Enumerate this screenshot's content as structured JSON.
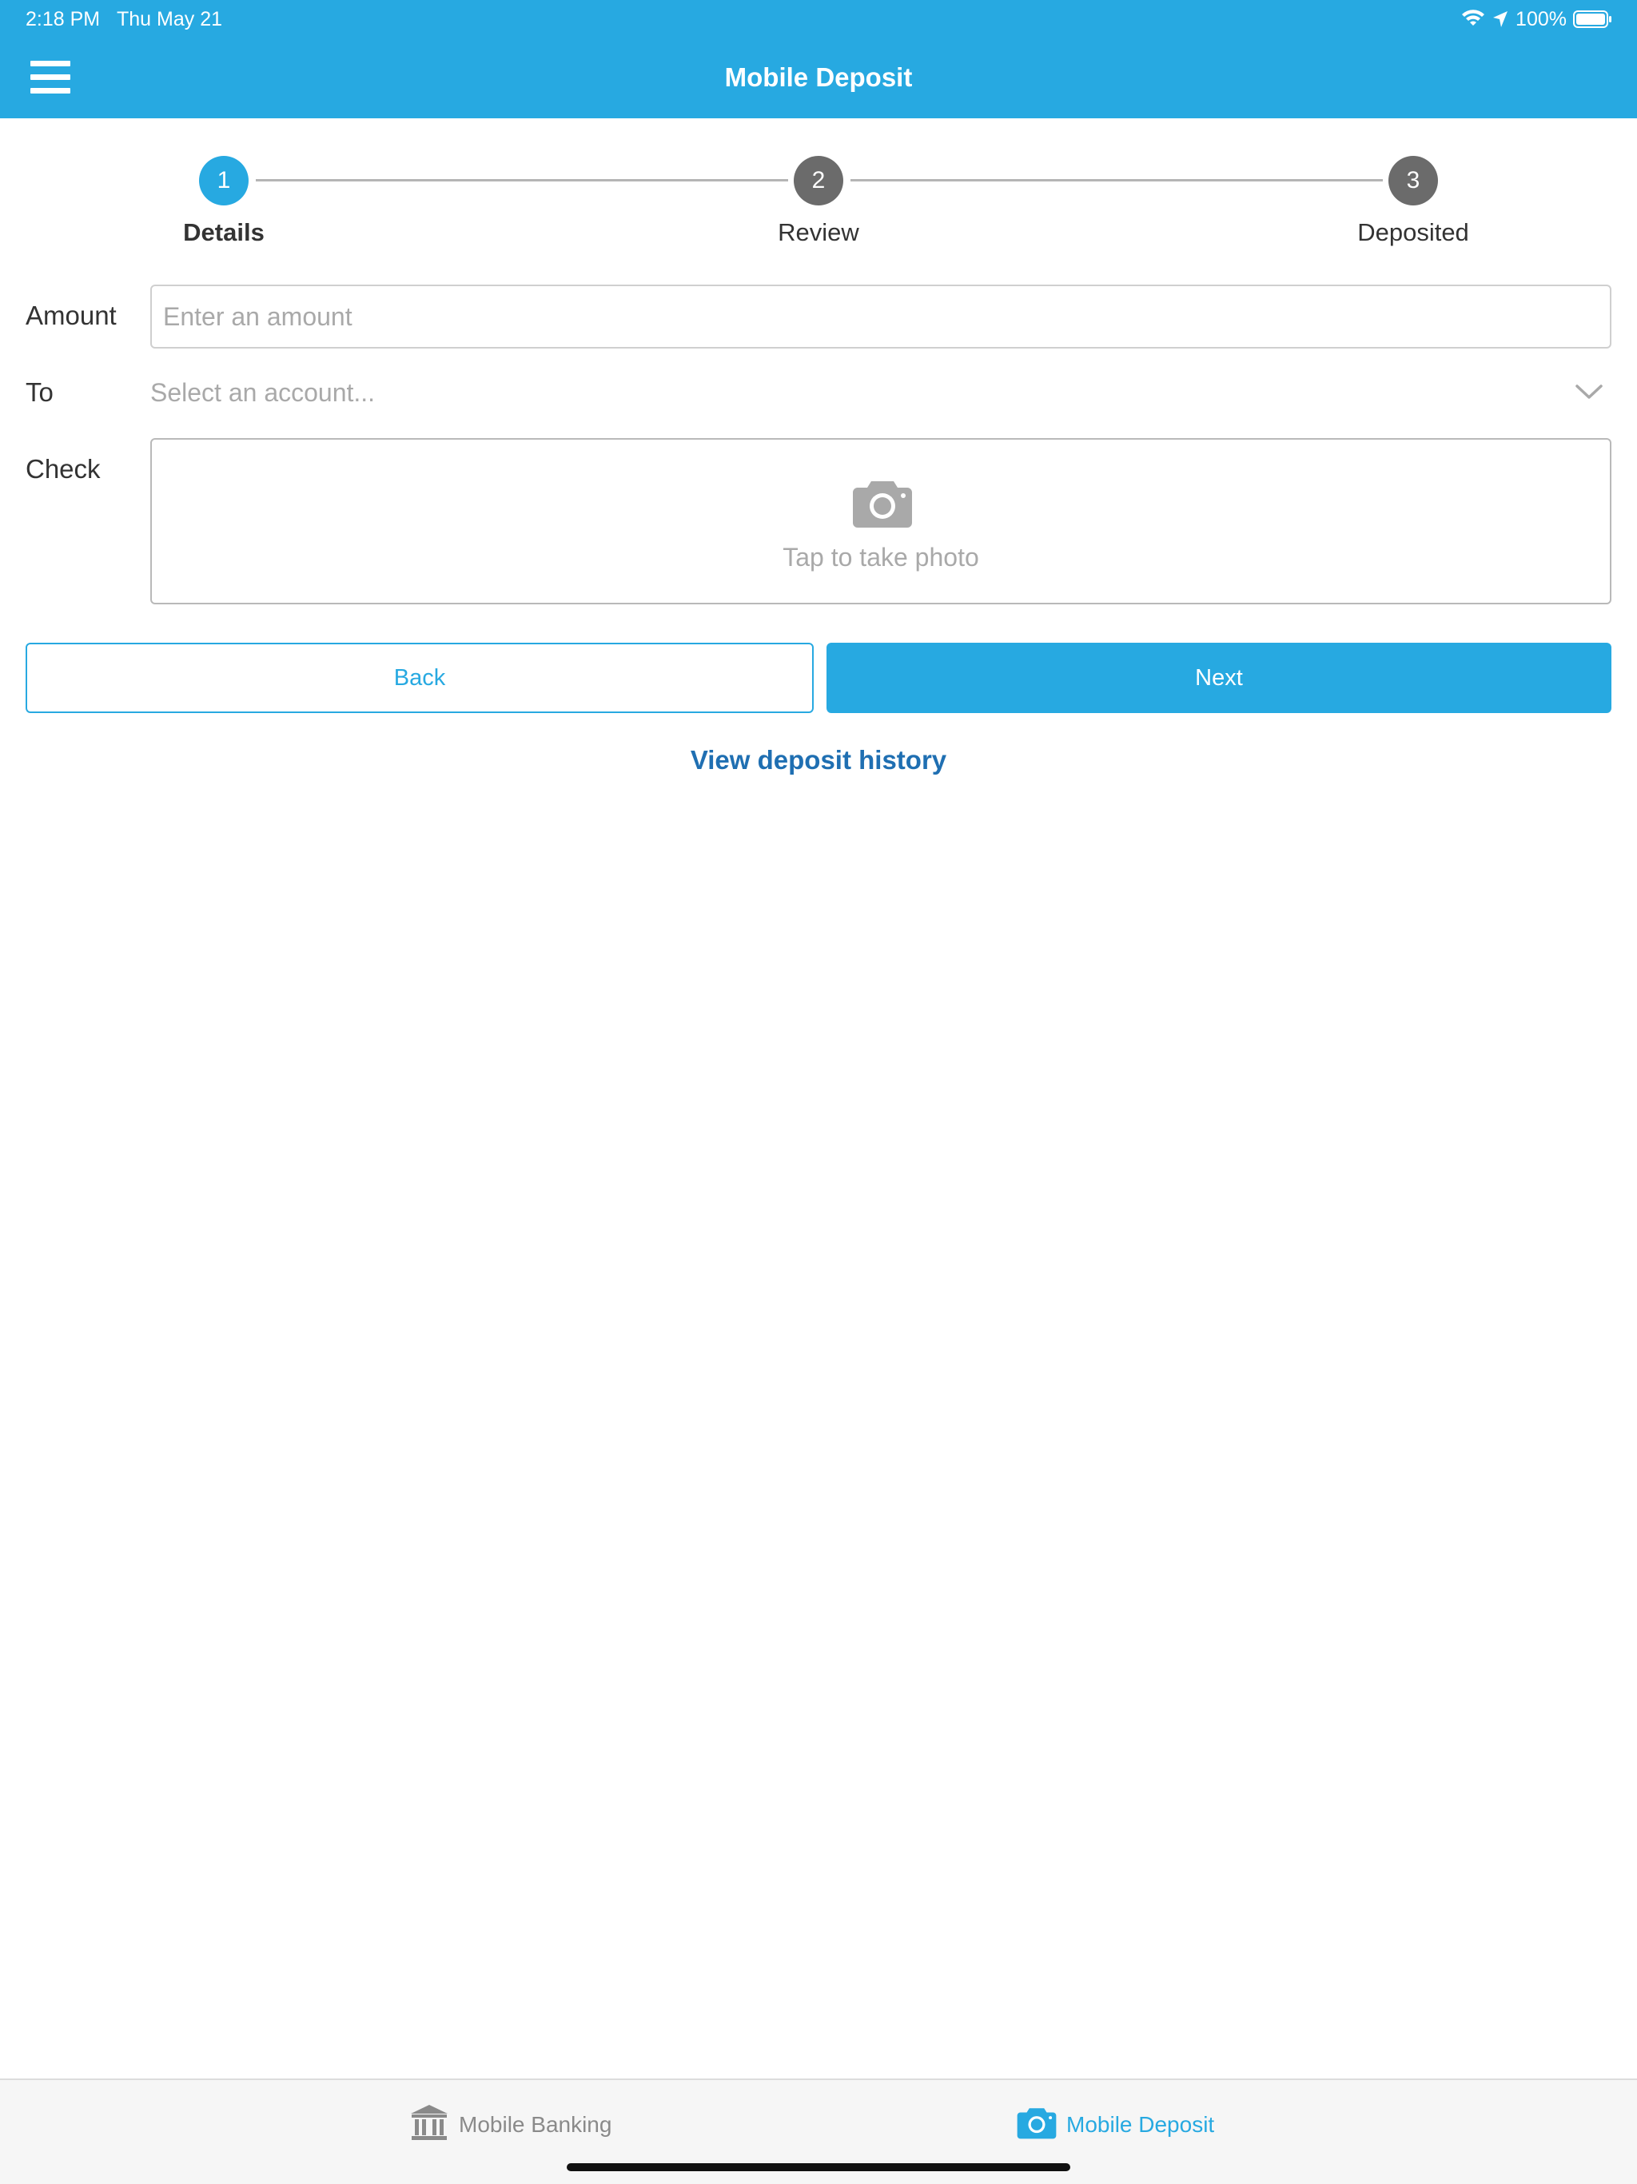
{
  "status_bar": {
    "time": "2:18 PM",
    "date": "Thu May 21",
    "battery": "100%"
  },
  "header": {
    "title": "Mobile Deposit"
  },
  "steps": [
    {
      "number": "1",
      "label": "Details",
      "state": "active"
    },
    {
      "number": "2",
      "label": "Review",
      "state": "inactive"
    },
    {
      "number": "3",
      "label": "Deposited",
      "state": "inactive"
    }
  ],
  "form": {
    "amount_label": "Amount",
    "amount_placeholder": "Enter an amount",
    "amount_value": "",
    "to_label": "To",
    "to_placeholder": "Select an account...",
    "check_label": "Check",
    "check_prompt": "Tap to take photo"
  },
  "buttons": {
    "back": "Back",
    "next": "Next"
  },
  "links": {
    "history": "View deposit history"
  },
  "tabs": [
    {
      "label": "Mobile Banking",
      "icon": "bank-icon",
      "active": false
    },
    {
      "label": "Mobile Deposit",
      "icon": "camera-icon",
      "active": true
    }
  ],
  "colors": {
    "brand": "#27a9e1",
    "step_inactive": "#6b6b6b",
    "link": "#1f6fb2",
    "placeholder": "#a9a9a9"
  }
}
